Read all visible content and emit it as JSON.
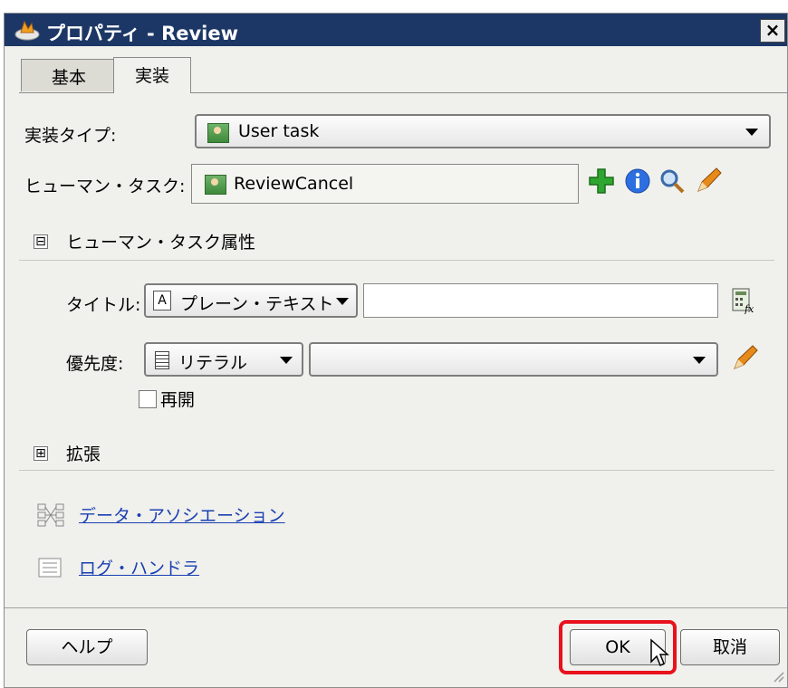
{
  "window": {
    "title": "プロパティ - Review",
    "close": "×"
  },
  "tabs": [
    {
      "label": "基本"
    },
    {
      "label": "実装"
    }
  ],
  "impl_type": {
    "label": "実装タイプ:",
    "value": "User task"
  },
  "human_task": {
    "label": "ヒューマン・タスク:",
    "value": "ReviewCancel"
  },
  "section_attrs": {
    "toggle": "⊟",
    "label": "ヒューマン・タスク属性"
  },
  "title_row": {
    "label": "タイトル:",
    "type_value": "プレーン・テキスト",
    "text_value": ""
  },
  "priority_row": {
    "label": "優先度:",
    "type_value": "リテラル",
    "value": ""
  },
  "reopen": {
    "label": "再開",
    "checked": false
  },
  "section_ext": {
    "toggle": "⊞",
    "label": "拡張"
  },
  "links": {
    "data_assoc": "データ・アソシエーション",
    "log_handler": "ログ・ハンドラ"
  },
  "buttons": {
    "help": "ヘルプ",
    "ok": "OK",
    "cancel": "取消"
  },
  "colors": {
    "titlebar": "#1c3765",
    "link": "#1a3fb3",
    "highlight": "#e8111c"
  }
}
